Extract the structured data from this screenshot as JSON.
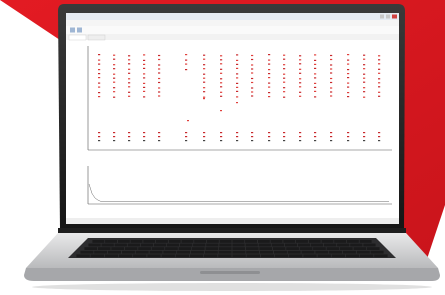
{
  "image": {
    "subject": "laptop-displaying-plot-software",
    "background_accent": "#d8151d",
    "screen_background": "#ffffff",
    "trace_colors": [
      "#c8282c",
      "#e0403c",
      "#444444"
    ]
  },
  "screen": {
    "window_title": "",
    "menu_items": [
      "",
      "",
      "",
      "",
      ""
    ],
    "toolbar_icons": [
      "open-icon",
      "save-icon"
    ],
    "tabs": [
      "",
      ""
    ],
    "top_plot": {
      "ylabel": "",
      "xlabel": ""
    },
    "bottom_plot": {
      "ylabel": "",
      "xlabel": ""
    },
    "status_bar": ""
  }
}
